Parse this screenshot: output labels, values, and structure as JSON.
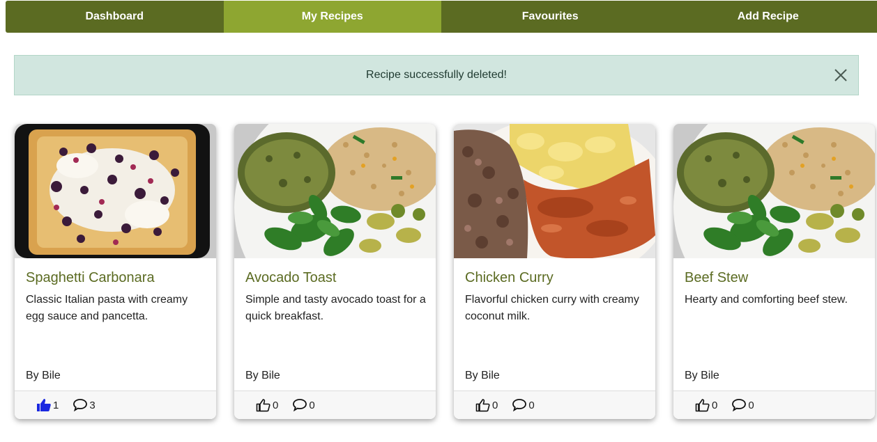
{
  "nav": {
    "items": [
      {
        "label": "Dashboard"
      },
      {
        "label": "My Recipes"
      },
      {
        "label": "Favourites"
      },
      {
        "label": "Add Recipe"
      }
    ],
    "active_index": 1
  },
  "alert": {
    "message": "Recipe successfully deleted!"
  },
  "colors": {
    "nav_bg": "#5b6b22",
    "nav_active": "#8ea631",
    "title": "#5b6b22",
    "alert_bg": "#d1e6df",
    "liked_icon": "#1a28e0"
  },
  "recipes": [
    {
      "title": "Spaghetti Carbonara",
      "description": "Classic Italian pasta with creamy egg sauce and pancetta.",
      "author": "By Bile",
      "likes": "1",
      "comments": "3",
      "liked": true,
      "image": "berry-cake"
    },
    {
      "title": "Avocado Toast",
      "description": "Simple and tasty avocado toast for a quick breakfast.",
      "author": "By Bile",
      "likes": "0",
      "comments": "0",
      "liked": false,
      "image": "patty-salad-plate"
    },
    {
      "title": "Chicken Curry",
      "description": "Flavorful chicken curry with creamy coconut milk.",
      "author": "By Bile",
      "likes": "0",
      "comments": "0",
      "liked": false,
      "image": "curry-mash-plate"
    },
    {
      "title": "Beef Stew",
      "description": "Hearty and comforting beef stew.",
      "author": "By Bile",
      "likes": "0",
      "comments": "0",
      "liked": false,
      "image": "patty-salad-plate"
    }
  ]
}
